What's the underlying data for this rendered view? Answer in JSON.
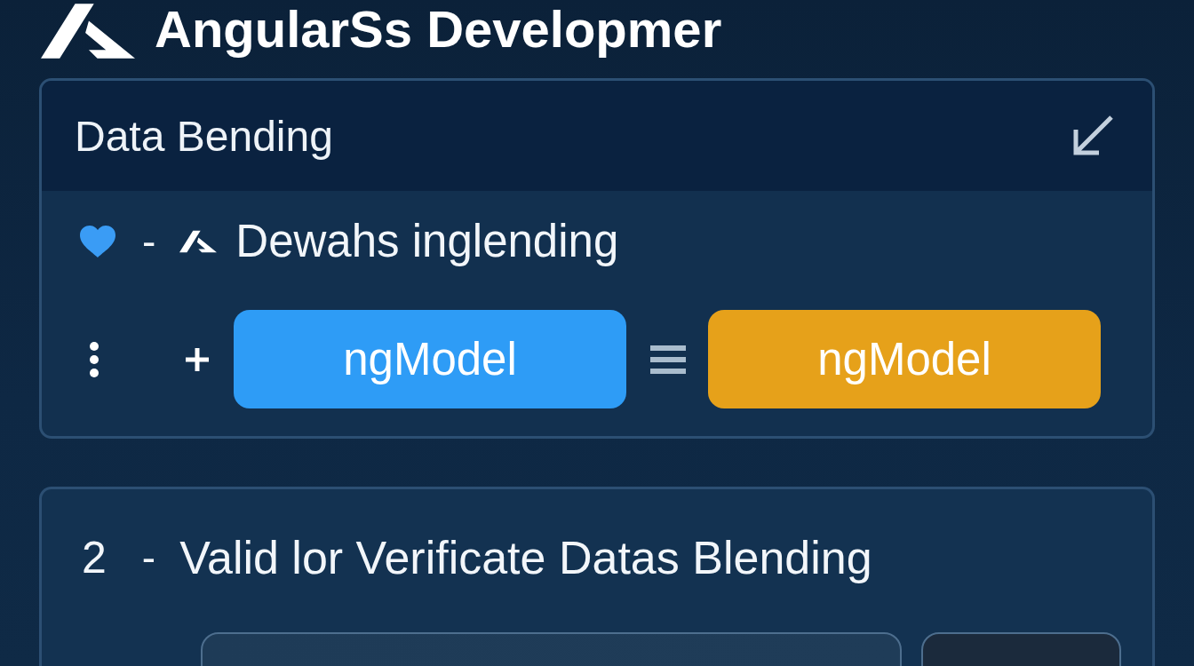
{
  "header": {
    "title": "AngularSs Developmer"
  },
  "binding_card": {
    "title": "Data Bending",
    "item": {
      "separator": "-",
      "label": "Dewahs inglending"
    },
    "chips": [
      {
        "label": "ngModel",
        "color": "#2e9cf6"
      },
      {
        "label": "ngModel",
        "color": "#e6a11a"
      }
    ]
  },
  "validation_card": {
    "number": "2",
    "separator": "-",
    "title": "Valid lor Verificate Datas Blending"
  }
}
